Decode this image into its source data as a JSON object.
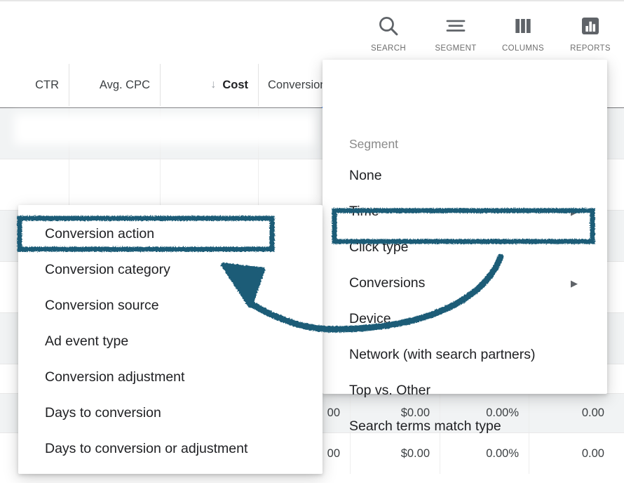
{
  "toolbar": {
    "items": [
      {
        "label": "SEARCH",
        "icon": "search-icon"
      },
      {
        "label": "SEGMENT",
        "icon": "segment-icon"
      },
      {
        "label": "COLUMNS",
        "icon": "columns-icon"
      },
      {
        "label": "REPORTS",
        "icon": "reports-icon"
      }
    ]
  },
  "table": {
    "headers": [
      {
        "label": "CTR",
        "sorted": false,
        "sort_indicator": ""
      },
      {
        "label": "Avg. CPC",
        "sorted": false,
        "sort_indicator": ""
      },
      {
        "label": "Cost",
        "sorted": true,
        "sort_indicator": "↓"
      },
      {
        "label": "Conversions",
        "sorted": false,
        "sort_indicator": ""
      }
    ],
    "rows": [
      {
        "shaded": true,
        "cells": [
          "00",
          "$0.00",
          "0.00%",
          "0.00"
        ]
      },
      {
        "shaded": false,
        "cells": [
          "00",
          "$0.00",
          "0.00%",
          "0.00"
        ]
      }
    ],
    "column_resize_indicator_color": "#4285f4"
  },
  "segment_menu": {
    "title": "Segment",
    "items": [
      {
        "label": "None",
        "has_submenu": false,
        "highlighted": false
      },
      {
        "label": "Time",
        "has_submenu": true,
        "highlighted": false
      },
      {
        "label": "Click type",
        "has_submenu": false,
        "highlighted": false
      },
      {
        "label": "Conversions",
        "has_submenu": true,
        "highlighted": true
      },
      {
        "label": "Device",
        "has_submenu": false,
        "highlighted": false
      },
      {
        "label": "Network (with search partners)",
        "has_submenu": false,
        "highlighted": false
      },
      {
        "label": "Top vs. Other",
        "has_submenu": false,
        "highlighted": false
      },
      {
        "label": "Search terms match type",
        "has_submenu": false,
        "highlighted": false
      }
    ],
    "caret_glyph": "▶"
  },
  "conversions_submenu": {
    "items": [
      {
        "label": "Conversion action",
        "highlighted": true
      },
      {
        "label": "Conversion category",
        "highlighted": false
      },
      {
        "label": "Conversion source",
        "highlighted": false
      },
      {
        "label": "Ad event type",
        "highlighted": false
      },
      {
        "label": "Conversion adjustment",
        "highlighted": false
      },
      {
        "label": "Days to conversion",
        "highlighted": false
      },
      {
        "label": "Days to conversion or adjustment",
        "highlighted": false
      }
    ]
  },
  "annotations": {
    "color": "#1b5b77",
    "highlight_box_conversions": "Conversions",
    "highlight_box_conversion_action": "Conversion action",
    "arrow": "curved-arrow-from-conversions-to-conversion-action"
  }
}
